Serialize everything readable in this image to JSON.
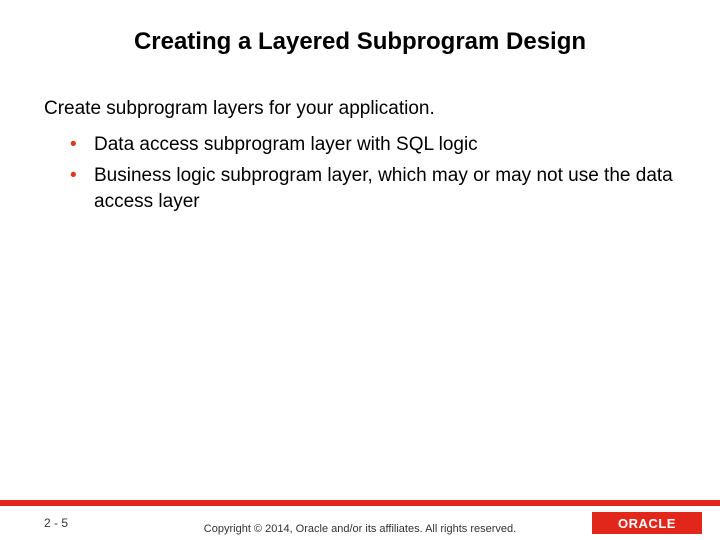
{
  "title": "Creating a Layered Subprogram Design",
  "lead": "Create subprogram layers for your application.",
  "bullets": [
    "Data access subprogram layer with SQL logic",
    "Business logic subprogram layer, which may or may not use the data access layer"
  ],
  "page_number": "2 - 5",
  "copyright": "Copyright © 2014, Oracle and/or its affiliates. All rights reserved.",
  "logo_text": "ORACLE"
}
